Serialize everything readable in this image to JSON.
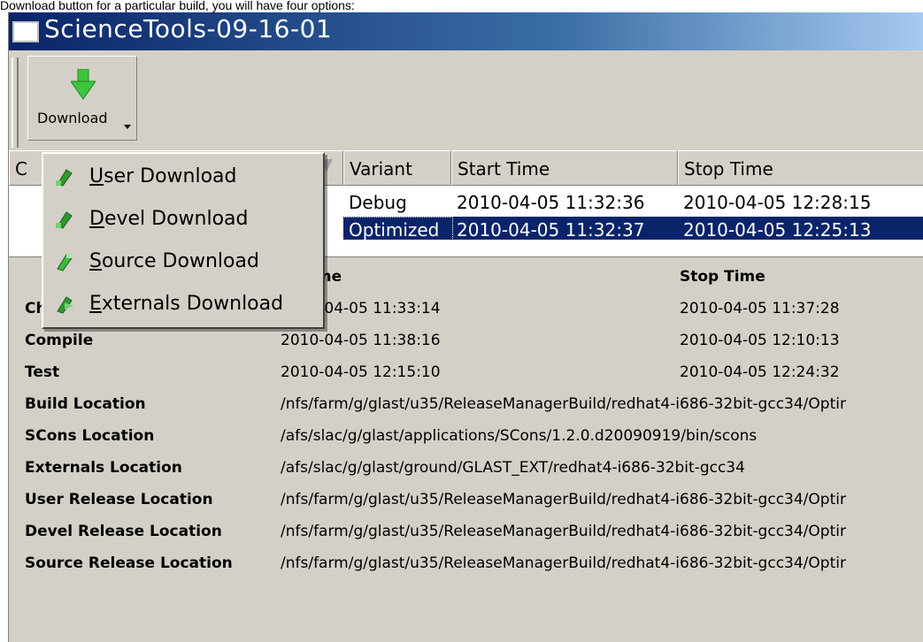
{
  "caption": "Download button for a particular build, you will have four options:",
  "window": {
    "title": "ScienceTools-09-16-01"
  },
  "toolbar": {
    "download_label": "Download"
  },
  "menu": {
    "items": [
      {
        "mnemonic": "U",
        "rest": "ser Download",
        "icon": "user-download-icon"
      },
      {
        "mnemonic": "D",
        "rest": "evel Download",
        "icon": "devel-download-icon"
      },
      {
        "mnemonic": "S",
        "rest": "ource Download",
        "icon": "source-download-icon"
      },
      {
        "mnemonic": "E",
        "rest": "xternals Download",
        "icon": "externals-download-icon"
      }
    ]
  },
  "grid": {
    "columns": [
      "C",
      "Variant",
      "Start Time",
      "Stop Time"
    ],
    "rows": [
      {
        "variant": "Debug",
        "start": "2010-04-05 11:32:36",
        "stop": "2010-04-05 12:28:15",
        "selected": false
      },
      {
        "variant": "Optimized",
        "start": "2010-04-05 11:32:37",
        "stop": "2010-04-05 12:25:13",
        "selected": true
      }
    ]
  },
  "details": {
    "header": {
      "col1_partial": "rt Time",
      "col2": "Stop Time"
    },
    "rows": [
      {
        "label": "Checkout",
        "v1": "2010-04-05 11:33:14",
        "v2": "2010-04-05 11:37:28"
      },
      {
        "label": "Compile",
        "v1": "2010-04-05 11:38:16",
        "v2": "2010-04-05 12:10:13"
      },
      {
        "label": "Test",
        "v1": "2010-04-05 12:15:10",
        "v2": "2010-04-05 12:24:32"
      },
      {
        "label": "Build Location",
        "v1": "/nfs/farm/g/glast/u35/ReleaseManagerBuild/redhat4-i686-32bit-gcc34/Optir",
        "v2": ""
      },
      {
        "label": "SCons Location",
        "v1": "/afs/slac/g/glast/applications/SCons/1.2.0.d20090919/bin/scons",
        "v2": ""
      },
      {
        "label": "Externals Location",
        "v1": "/afs/slac/g/glast/ground/GLAST_EXT/redhat4-i686-32bit-gcc34",
        "v2": ""
      },
      {
        "label": "User Release Location",
        "v1": "/nfs/farm/g/glast/u35/ReleaseManagerBuild/redhat4-i686-32bit-gcc34/Optir",
        "v2": ""
      },
      {
        "label": "Devel Release Location",
        "v1": "/nfs/farm/g/glast/u35/ReleaseManagerBuild/redhat4-i686-32bit-gcc34/Optir",
        "v2": ""
      },
      {
        "label": "Source Release Location",
        "v1": "/nfs/farm/g/glast/u35/ReleaseManagerBuild/redhat4-i686-32bit-gcc34/Optir",
        "v2": ""
      }
    ]
  },
  "colors": {
    "selection": "#0a246a",
    "face": "#d4d0c8",
    "arrow": "#3ec43e"
  }
}
